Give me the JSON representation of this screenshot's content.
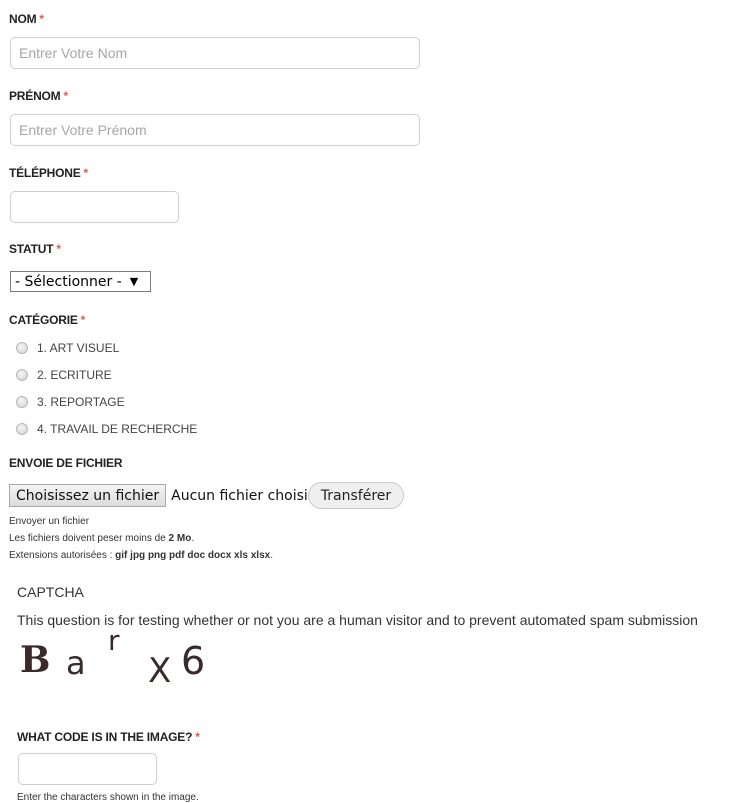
{
  "form": {
    "nom": {
      "label": "NOM",
      "required_mark": "*",
      "placeholder": "Entrer Votre Nom"
    },
    "prenom": {
      "label": "PRÉNOM",
      "required_mark": "*",
      "placeholder": "Entrer Votre Prénom"
    },
    "telephone": {
      "label": "TÉLÉPHONE",
      "required_mark": "*",
      "value": ""
    },
    "statut": {
      "label": "STATUT",
      "required_mark": "*",
      "selected": "- Sélectionner -",
      "arrow": "▼"
    },
    "categorie": {
      "label": "CATÉGORIE",
      "required_mark": "*",
      "options": [
        "1. ART VISUEL",
        "2. ECRITURE",
        "3. REPORTAGE",
        "4. TRAVAIL DE RECHERCHE"
      ]
    },
    "fichier": {
      "label": "ENVOIE DE FICHIER",
      "choose_button": "Choisissez un fichier",
      "no_file_text": "Aucun fichier choisi",
      "upload_button": "Transférer",
      "help_1": "Envoyer un fichier",
      "help_2_prefix": "Les fichiers doivent peser moins de ",
      "help_2_size": "2 Mo",
      "help_2_suffix": ".",
      "help_3_prefix": "Extensions autorisées : ",
      "help_3_ext": "gif jpg png pdf doc docx xls xlsx",
      "help_3_suffix": "."
    },
    "captcha": {
      "title": "CAPTCHA",
      "description": "This question is for testing whether or not you are a human visitor and to prevent automated spam submission",
      "image_text": "BarX6",
      "code_label": "WHAT CODE IS IN THE IMAGE?",
      "required_mark": "*",
      "value": "",
      "help": "Enter the characters shown in the image."
    }
  },
  "colors": {
    "required": "#e05a4f",
    "captcha_ink": "#3a2a2a"
  }
}
